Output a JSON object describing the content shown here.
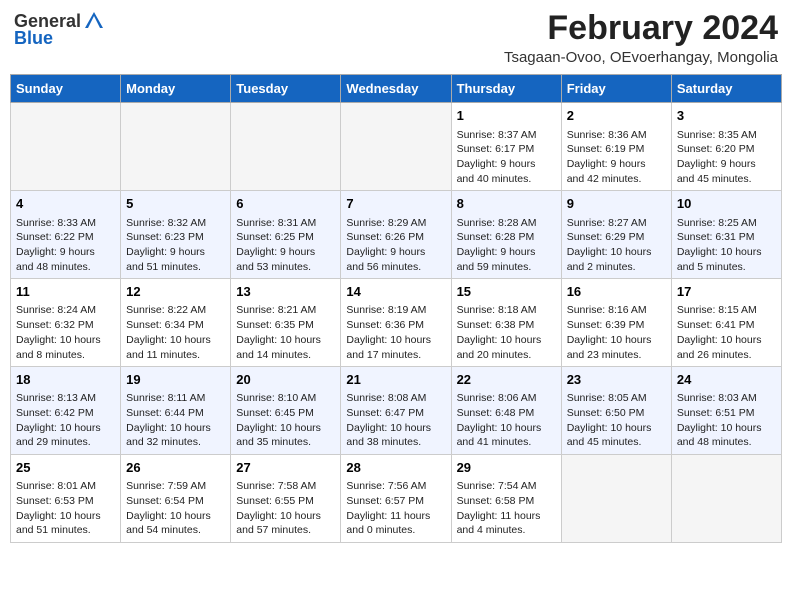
{
  "header": {
    "logo_general": "General",
    "logo_blue": "Blue",
    "month_year": "February 2024",
    "location": "Tsagaan-Ovoo, OEvoerhangay, Mongolia"
  },
  "days_of_week": [
    "Sunday",
    "Monday",
    "Tuesday",
    "Wednesday",
    "Thursday",
    "Friday",
    "Saturday"
  ],
  "weeks": [
    [
      {
        "day": "",
        "info": ""
      },
      {
        "day": "",
        "info": ""
      },
      {
        "day": "",
        "info": ""
      },
      {
        "day": "",
        "info": ""
      },
      {
        "day": "1",
        "info": "Sunrise: 8:37 AM\nSunset: 6:17 PM\nDaylight: 9 hours and 40 minutes."
      },
      {
        "day": "2",
        "info": "Sunrise: 8:36 AM\nSunset: 6:19 PM\nDaylight: 9 hours and 42 minutes."
      },
      {
        "day": "3",
        "info": "Sunrise: 8:35 AM\nSunset: 6:20 PM\nDaylight: 9 hours and 45 minutes."
      }
    ],
    [
      {
        "day": "4",
        "info": "Sunrise: 8:33 AM\nSunset: 6:22 PM\nDaylight: 9 hours and 48 minutes."
      },
      {
        "day": "5",
        "info": "Sunrise: 8:32 AM\nSunset: 6:23 PM\nDaylight: 9 hours and 51 minutes."
      },
      {
        "day": "6",
        "info": "Sunrise: 8:31 AM\nSunset: 6:25 PM\nDaylight: 9 hours and 53 minutes."
      },
      {
        "day": "7",
        "info": "Sunrise: 8:29 AM\nSunset: 6:26 PM\nDaylight: 9 hours and 56 minutes."
      },
      {
        "day": "8",
        "info": "Sunrise: 8:28 AM\nSunset: 6:28 PM\nDaylight: 9 hours and 59 minutes."
      },
      {
        "day": "9",
        "info": "Sunrise: 8:27 AM\nSunset: 6:29 PM\nDaylight: 10 hours and 2 minutes."
      },
      {
        "day": "10",
        "info": "Sunrise: 8:25 AM\nSunset: 6:31 PM\nDaylight: 10 hours and 5 minutes."
      }
    ],
    [
      {
        "day": "11",
        "info": "Sunrise: 8:24 AM\nSunset: 6:32 PM\nDaylight: 10 hours and 8 minutes."
      },
      {
        "day": "12",
        "info": "Sunrise: 8:22 AM\nSunset: 6:34 PM\nDaylight: 10 hours and 11 minutes."
      },
      {
        "day": "13",
        "info": "Sunrise: 8:21 AM\nSunset: 6:35 PM\nDaylight: 10 hours and 14 minutes."
      },
      {
        "day": "14",
        "info": "Sunrise: 8:19 AM\nSunset: 6:36 PM\nDaylight: 10 hours and 17 minutes."
      },
      {
        "day": "15",
        "info": "Sunrise: 8:18 AM\nSunset: 6:38 PM\nDaylight: 10 hours and 20 minutes."
      },
      {
        "day": "16",
        "info": "Sunrise: 8:16 AM\nSunset: 6:39 PM\nDaylight: 10 hours and 23 minutes."
      },
      {
        "day": "17",
        "info": "Sunrise: 8:15 AM\nSunset: 6:41 PM\nDaylight: 10 hours and 26 minutes."
      }
    ],
    [
      {
        "day": "18",
        "info": "Sunrise: 8:13 AM\nSunset: 6:42 PM\nDaylight: 10 hours and 29 minutes."
      },
      {
        "day": "19",
        "info": "Sunrise: 8:11 AM\nSunset: 6:44 PM\nDaylight: 10 hours and 32 minutes."
      },
      {
        "day": "20",
        "info": "Sunrise: 8:10 AM\nSunset: 6:45 PM\nDaylight: 10 hours and 35 minutes."
      },
      {
        "day": "21",
        "info": "Sunrise: 8:08 AM\nSunset: 6:47 PM\nDaylight: 10 hours and 38 minutes."
      },
      {
        "day": "22",
        "info": "Sunrise: 8:06 AM\nSunset: 6:48 PM\nDaylight: 10 hours and 41 minutes."
      },
      {
        "day": "23",
        "info": "Sunrise: 8:05 AM\nSunset: 6:50 PM\nDaylight: 10 hours and 45 minutes."
      },
      {
        "day": "24",
        "info": "Sunrise: 8:03 AM\nSunset: 6:51 PM\nDaylight: 10 hours and 48 minutes."
      }
    ],
    [
      {
        "day": "25",
        "info": "Sunrise: 8:01 AM\nSunset: 6:53 PM\nDaylight: 10 hours and 51 minutes."
      },
      {
        "day": "26",
        "info": "Sunrise: 7:59 AM\nSunset: 6:54 PM\nDaylight: 10 hours and 54 minutes."
      },
      {
        "day": "27",
        "info": "Sunrise: 7:58 AM\nSunset: 6:55 PM\nDaylight: 10 hours and 57 minutes."
      },
      {
        "day": "28",
        "info": "Sunrise: 7:56 AM\nSunset: 6:57 PM\nDaylight: 11 hours and 0 minutes."
      },
      {
        "day": "29",
        "info": "Sunrise: 7:54 AM\nSunset: 6:58 PM\nDaylight: 11 hours and 4 minutes."
      },
      {
        "day": "",
        "info": ""
      },
      {
        "day": "",
        "info": ""
      }
    ]
  ]
}
